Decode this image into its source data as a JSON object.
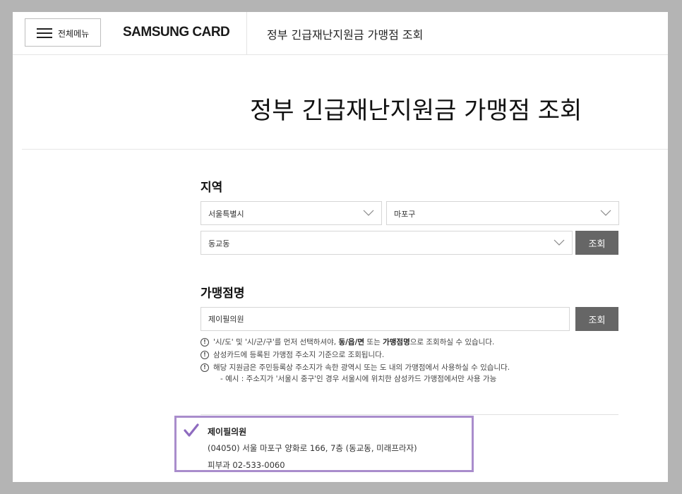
{
  "header": {
    "menu_label": "전체메뉴",
    "brand": "SAMSUNG CARD",
    "title": "정부 긴급재난지원금 가맹점 조회"
  },
  "page_title": "정부 긴급재난지원금 가맹점 조회",
  "region": {
    "label": "지역",
    "province": "서울특별시",
    "district": "마포구",
    "dong": "동교동",
    "search_label": "조회"
  },
  "merchant": {
    "label": "가맹점명",
    "value": "제이필의원",
    "search_label": "조회"
  },
  "notes": {
    "note1_a": "'시/도' 및 '시/군/구'를 먼저 선택하셔야, ",
    "note1_b": "동/읍/면",
    "note1_c": " 또는 ",
    "note1_d": "가맹점명",
    "note1_e": "으로 조회하실 수 있습니다.",
    "note2": "삼성카드에 등록된 가맹점 주소지 기준으로 조회됩니다.",
    "note3": "해당 지원금은 주민등록상 주소지가 속한 광역시 또는 도 내의 가맹점에서 사용하실 수 있습니다.",
    "note3_sub": "- 예시 : 주소지가 '서울시 중구'인 경우 서울시에 위치한 삼성카드 가맹점에서만 사용 가능"
  },
  "result": {
    "name": "제이필의원",
    "address": "(04050) 서울 마포구 양화로 166, 7층 (동교동, 미래프라자)",
    "category_phone": "피부과 02-533-0060"
  },
  "colors": {
    "button_bg": "#666666",
    "highlight_border": "#a98dcc",
    "checkmark": "#8e6bbf"
  }
}
